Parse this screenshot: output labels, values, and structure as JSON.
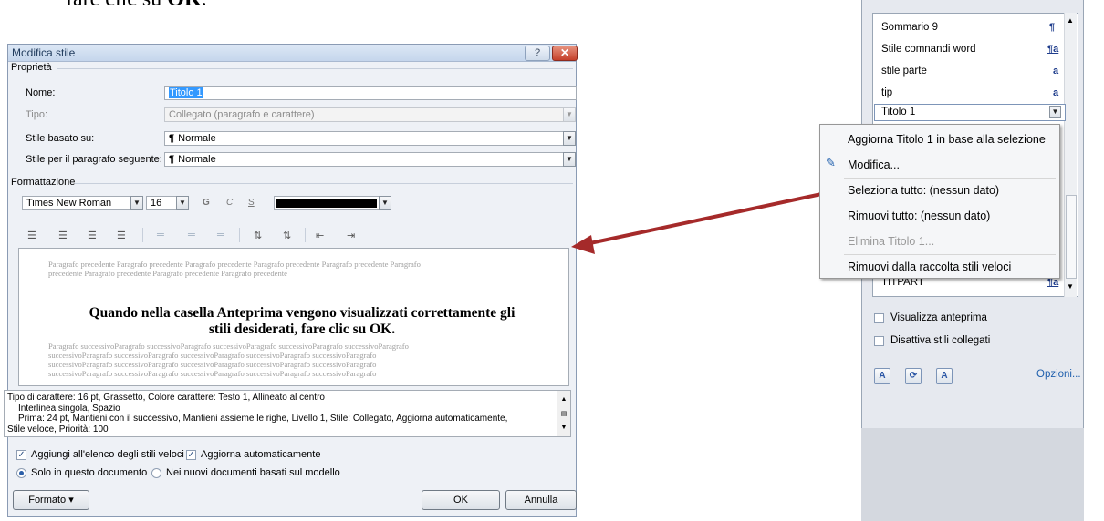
{
  "doc": {
    "text_prefix": "fare clic su ",
    "text_bold": "OK",
    "text_suffix": "."
  },
  "dialog": {
    "title": "Modifica stile",
    "help_label": "?",
    "close_label": "✕",
    "section_properties": "Proprietà",
    "name_label": "Nome:",
    "name_value": "Titolo 1",
    "type_label": "Tipo:",
    "type_value": "Collegato (paragrafo e carattere)",
    "based_label": "Stile basato su:",
    "based_value": "Normale",
    "next_label": "Stile per il paragrafo seguente:",
    "next_value": "Normale",
    "section_formatting": "Formattazione",
    "font_value": "Times New Roman",
    "size_value": "16",
    "bold_label": "G",
    "italic_label": "C",
    "underline_label": "S",
    "color_value": "#000000",
    "preview": {
      "prev_line1": "Paragrafo precedente Paragrafo precedente Paragrafo precedente Paragrafo precedente Paragrafo precedente Paragrafo",
      "prev_line2": "precedente Paragrafo precedente Paragrafo precedente Paragrafo precedente",
      "main_line1": "Quando nella casella Anteprima vengono visualizzati correttamente gli",
      "main_line2": "stili desiderati, fare clic su OK.",
      "next_line1": "Paragrafo successivoParagrafo successivoParagrafo successivoParagrafo successivoParagrafo successivoParagrafo",
      "next_line2": "successivoParagrafo successivoParagrafo successivoParagrafo successivoParagrafo successivoParagrafo",
      "next_line3": "successivoParagrafo successivoParagrafo successivoParagrafo successivoParagrafo successivoParagrafo",
      "next_line4": "successivoParagrafo successivoParagrafo successivoParagrafo successivoParagrafo successivoParagrafo"
    },
    "description": {
      "line1": "Tipo di carattere: 16 pt, Grassetto, Colore carattere: Testo 1, Allineato al centro",
      "line2": "Interlinea singola, Spazio",
      "line3": "Prima:  24 pt, Mantieni con il successivo, Mantieni assieme le righe, Livello 1, Stile: Collegato, Aggiorna automaticamente,",
      "line4": "Stile veloce, Priorità: 100"
    },
    "add_quick_label": "Aggiungi all'elenco degli stili veloci",
    "auto_update_label": "Aggiorna automaticamente",
    "only_doc_label": "Solo in questo documento",
    "new_docs_label": "Nei nuovi documenti basati sul modello",
    "format_button": "Formato ▾",
    "ok_button": "OK",
    "cancel_button": "Annulla"
  },
  "pane": {
    "items": [
      {
        "label": "Sommario 9",
        "mark": "¶"
      },
      {
        "label": "Stile comnandi word",
        "mark": "¶a"
      },
      {
        "label": "stile parte",
        "mark": "a"
      },
      {
        "label": "tip",
        "mark": "a"
      }
    ],
    "selected_label": "Titolo 1",
    "partial_item": "TITPART",
    "partial_mark": "¶a",
    "show_preview_label": "Visualizza anteprima",
    "disable_linked_label": "Disattiva stili collegati",
    "options_link": "Opzioni...",
    "menu": {
      "update": "Aggiorna Titolo 1 in base alla selezione",
      "modify": "Modifica...",
      "select_all": "Seleziona tutto: (nessun dato)",
      "remove_all": "Rimuovi tutto: (nessun dato)",
      "delete": "Elimina Titolo 1...",
      "remove_gallery": "Rimuovi dalla raccolta stili veloci"
    }
  }
}
